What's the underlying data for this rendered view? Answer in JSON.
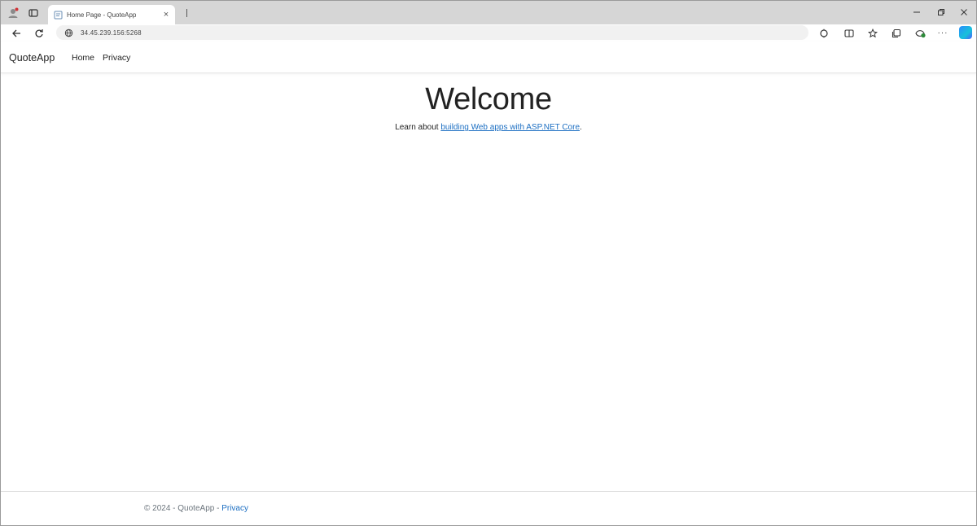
{
  "browser": {
    "tab": {
      "title": "Home Page - QuoteApp",
      "close_glyph": "×"
    },
    "address": {
      "url": "34.45.239.156:5268"
    },
    "window_controls": {
      "minimize": "—",
      "maximize": "❐",
      "close": "✕"
    },
    "more_glyph": "···"
  },
  "app": {
    "brand": "QuoteApp",
    "nav": [
      {
        "label": "Home"
      },
      {
        "label": "Privacy"
      }
    ],
    "main": {
      "heading": "Welcome",
      "learn_prefix": "Learn about ",
      "learn_link": "building Web apps with ASP.NET Core",
      "learn_suffix": "."
    },
    "footer": {
      "copyright": "© 2024 - QuoteApp - ",
      "privacy_link": "Privacy"
    }
  },
  "colors": {
    "link": "#1b6ec2",
    "tabstrip": "#d6d6d6",
    "footer_text": "#6c757d"
  },
  "icons": {
    "profile": "profile-icon",
    "workspaces": "tab-actions-icon",
    "back": "back-arrow-icon",
    "refresh": "refresh-icon",
    "site_info": "site-info-icon",
    "extensions": "extensions-icon",
    "split_screen": "split-screen-icon",
    "favorites": "favorites-icon",
    "collections": "collections-icon",
    "browser_essentials": "browser-essentials-icon",
    "copilot": "copilot-icon"
  }
}
